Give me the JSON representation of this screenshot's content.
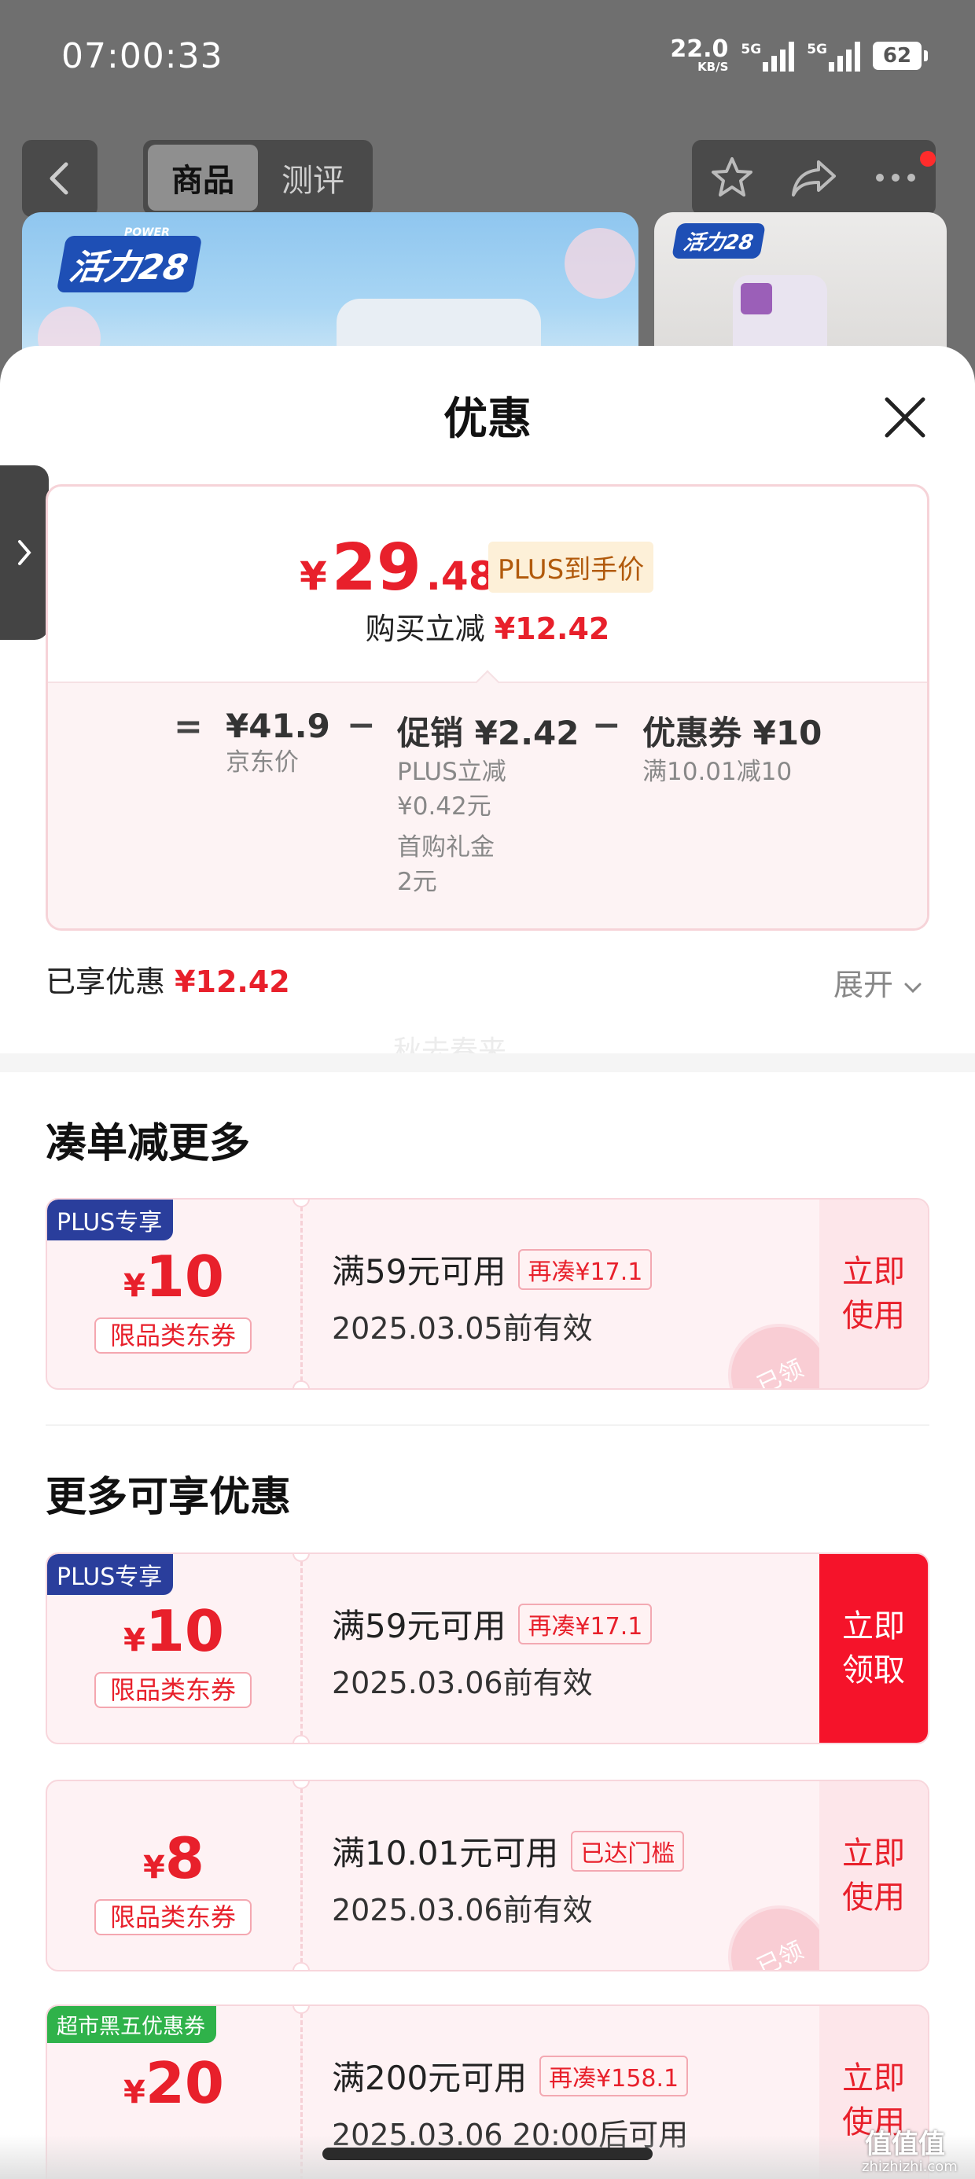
{
  "status_bar": {
    "time": "07:00:33",
    "net_speed": "22.0",
    "net_unit": "KB/S",
    "sim1": "5G",
    "sim2": "5G",
    "battery": "62"
  },
  "product_bar": {
    "tabs": [
      {
        "label": "商品",
        "active": true
      },
      {
        "label": "测评",
        "active": false
      }
    ],
    "icons": [
      "back-icon",
      "star-icon",
      "share-icon",
      "more-icon"
    ],
    "brand_logo": "活力28",
    "brand_small": "POWER"
  },
  "sheet": {
    "title": "优惠"
  },
  "price": {
    "currency": "¥",
    "integer": "29",
    "decimal": ".48",
    "tag": "PLUS到手价",
    "instant_label": "购买立减",
    "instant_amount": "¥12.42",
    "equals": "=",
    "minus": "−",
    "jd_price": "¥41.9",
    "jd_label": "京东价",
    "promo_title": "促销 ¥2.42",
    "promo_line1": "PLUS立减",
    "promo_line2": "¥0.42元",
    "promo_line3": "首购礼金",
    "promo_line4": "2元",
    "coupon_title": "优惠券 ¥10",
    "coupon_rule": "满10.01减10"
  },
  "summary": {
    "enjoyed_label": "已享优惠",
    "enjoyed_amount": "¥12.42",
    "expand_label": "展开",
    "watermark": "秋去春来"
  },
  "sections": {
    "more_saving": "凑单减更多",
    "more_offers": "更多可享优惠"
  },
  "coupons": [
    {
      "tag": "PLUS专享",
      "currency": "¥",
      "amount": "10",
      "kind": "限品类东券",
      "condition": "满59元可用",
      "pill": "再凑¥17.1",
      "validity": "2025.03.05前有效",
      "action_line1": "立即",
      "action_line2": "使用",
      "stamp": "已领"
    },
    {
      "tag": "PLUS专享",
      "currency": "¥",
      "amount": "10",
      "kind": "限品类东券",
      "condition": "满59元可用",
      "pill": "再凑¥17.1",
      "validity": "2025.03.06前有效",
      "action_line1": "立即",
      "action_line2": "领取"
    },
    {
      "currency": "¥",
      "amount": "8",
      "kind": "限品类东券",
      "condition": "满10.01元可用",
      "pill": "已达门槛",
      "validity": "2025.03.06前有效",
      "action_line1": "立即",
      "action_line2": "使用",
      "stamp": "已领"
    },
    {
      "tag": "超市黑五优惠券",
      "currency": "¥",
      "amount": "20",
      "kind": "",
      "condition": "满200元可用",
      "pill": "再凑¥158.1",
      "validity": "2025.03.06 20:00后可用",
      "action_line1": "立即",
      "action_line2": "使用"
    }
  ],
  "overlay": {
    "corner_mark": "值值值",
    "corner_url": "zhizhizhi.com"
  },
  "colors": {
    "accent_red": "#e8202b",
    "plus_blue": "#2a3e9c",
    "promo_green": "#2fb24a",
    "plus_tag_bg": "#fdf0d8"
  }
}
